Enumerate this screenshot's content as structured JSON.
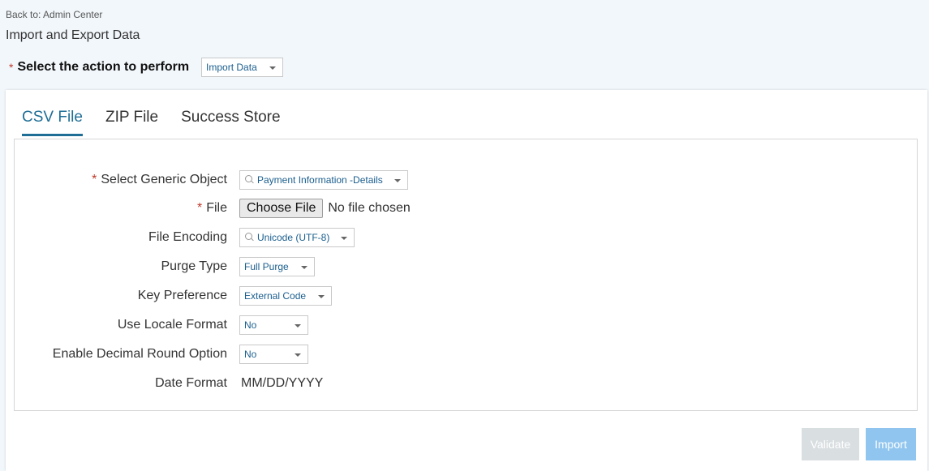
{
  "header": {
    "back_link": "Back to: Admin Center",
    "title": "Import and Export Data"
  },
  "action": {
    "required_mark": "*",
    "label": "Select the action to perform",
    "selected": "Import Data"
  },
  "tabs": [
    {
      "label": "CSV File",
      "active": true
    },
    {
      "label": "ZIP File",
      "active": false
    },
    {
      "label": "Success Store",
      "active": false
    }
  ],
  "form": {
    "generic_object": {
      "required_mark": "*",
      "label": "Select Generic Object",
      "value": "Payment Information -Details",
      "icon": "search-icon"
    },
    "file": {
      "required_mark": "*",
      "label": "File",
      "button": "Choose File",
      "status": "No file chosen"
    },
    "file_encoding": {
      "label": "File Encoding",
      "value": "Unicode (UTF-8)",
      "icon": "search-icon"
    },
    "purge_type": {
      "label": "Purge Type",
      "value": "Full Purge"
    },
    "key_preference": {
      "label": "Key Preference",
      "value": "External Code"
    },
    "use_locale_format": {
      "label": "Use Locale Format",
      "value": "No"
    },
    "decimal_round": {
      "label": "Enable Decimal Round Option",
      "value": "No"
    },
    "date_format": {
      "label": "Date Format",
      "value": "MM/DD/YYYY"
    }
  },
  "buttons": {
    "validate": "Validate",
    "import": "Import"
  },
  "colors": {
    "accent": "#1f6e96",
    "required": "#c0392b",
    "import_button": "#8fc5ef",
    "validate_button": "#d9dee1"
  }
}
